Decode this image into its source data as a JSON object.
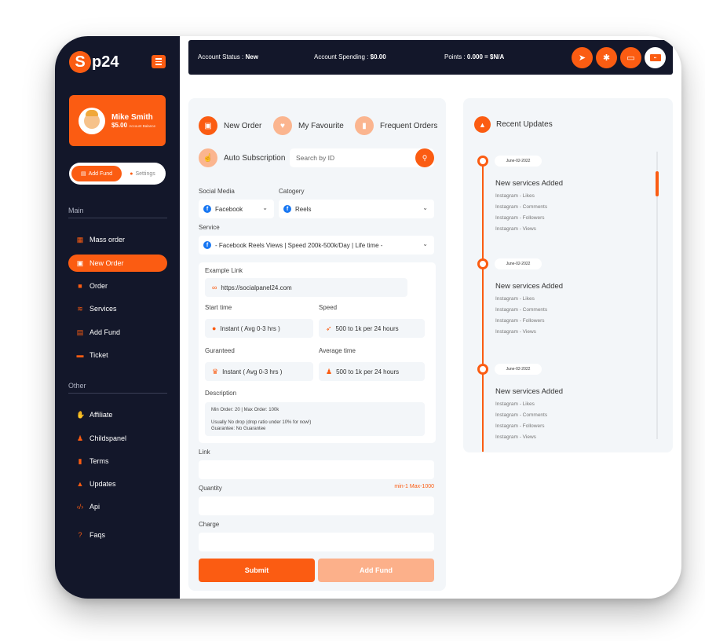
{
  "brand": {
    "logo_letter": "S",
    "logo_rest": "p24"
  },
  "profile": {
    "name": "Mike Smith",
    "balance": "$5.00",
    "balance_caption": "Account Balance"
  },
  "toggle": {
    "add_fund": "Add Fund",
    "settings": "Settings"
  },
  "sidebar": {
    "main_title": "Main",
    "main_items": [
      {
        "label": "Mass order",
        "icon": "grid-icon"
      },
      {
        "label": "New Order",
        "icon": "cart-icon",
        "active": true
      },
      {
        "label": "Order",
        "icon": "box-icon"
      },
      {
        "label": "Services",
        "icon": "layers-icon"
      },
      {
        "label": "Add Fund",
        "icon": "wallet-icon"
      },
      {
        "label": "Ticket",
        "icon": "ticket-icon"
      }
    ],
    "other_title": "Other",
    "other_items": [
      {
        "label": "Affiliate",
        "icon": "handshake-icon"
      },
      {
        "label": "Childspanel",
        "icon": "person-icon"
      },
      {
        "label": "Terms",
        "icon": "document-icon"
      },
      {
        "label": "Updates",
        "icon": "bell-icon"
      },
      {
        "label": "Api",
        "icon": "code-icon"
      },
      {
        "label": "Faqs",
        "icon": "question-icon"
      }
    ]
  },
  "topbar": {
    "status_label": "Account Status :",
    "status_value": "New",
    "spending_label": "Account Spending :",
    "spending_value": "$0.00",
    "points_label": "Points :",
    "points_value": "0.000 = $N/A",
    "icons": [
      "telegram-icon",
      "gear-icon",
      "money-icon",
      "flag-icon"
    ]
  },
  "order": {
    "tabs": {
      "new_order": "New Order",
      "favourite": "My Favourite",
      "frequent": "Frequent Orders",
      "auto": "Auto Subscription"
    },
    "search_placeholder": "Search by ID",
    "social_label": "Social Media",
    "social_value": "Facebook",
    "category_label": "Catogery",
    "category_value": "Reels",
    "service_label": "Service",
    "service_value": "- Facebook Reels Views | Speed 200k-500k/Day | Life time -",
    "info": {
      "example_label": "Example Link",
      "example_value": "https://socialpanel24.com",
      "start_label": "Start time",
      "start_value": "Instant ( Avg 0-3 hrs )",
      "speed_label": "Speed",
      "speed_value": "500 to 1k per 24 hours",
      "guarantee_label": "Guranteed",
      "guarantee_value": "Instant ( Avg 0-3 hrs )",
      "avg_label": "Average time",
      "avg_value": "500 to 1k per 24 hours",
      "desc_label": "Description",
      "desc_line1": "Min Order: 20 | Max Order: 100k",
      "desc_line2": "Usually No drop (drop ratio under 10% for now!)",
      "desc_line3": "Guarantee: No Guarantee"
    },
    "link_label": "Link",
    "quantity_label": "Quantity",
    "quantity_hint": "min-1  Max-1000",
    "charge_label": "Charge",
    "submit": "Submit",
    "add_fund": "Add Fund"
  },
  "updates": {
    "title": "Recent Updates",
    "items": [
      {
        "date": "June-02-2022",
        "title": "New services Added",
        "lines": [
          "Instagram - Likes",
          "Instagram - Comments",
          "Instagram - Followers",
          "Instagram - Views"
        ]
      },
      {
        "date": "June-02-2022",
        "title": "New services Added",
        "lines": [
          "Instagram - Likes",
          "Instagram - Comments",
          "Instagram - Followers",
          "Instagram - Views"
        ]
      },
      {
        "date": "June-02-2022",
        "title": "New services Added",
        "lines": [
          "Instagram - Likes",
          "Instagram - Comments",
          "Instagram - Followers",
          "Instagram - Views"
        ]
      }
    ]
  },
  "colors": {
    "accent": "#fb5c12",
    "sidebar_bg": "#13172a",
    "panel_bg": "#f3f6f9",
    "accent_light": "#fbb58f"
  }
}
